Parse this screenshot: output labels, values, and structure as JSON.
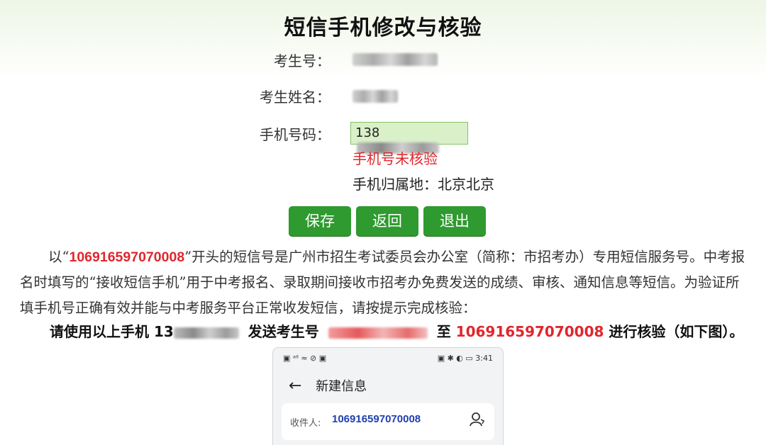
{
  "page": {
    "title": "短信手机修改与核验"
  },
  "form": {
    "exam_id_label": "考生号：",
    "name_label": "考生姓名：",
    "phone_label": "手机号码：",
    "phone_value": "138",
    "phone_status": "手机号未核验",
    "phone_location": "手机归属地：北京北京"
  },
  "buttons": {
    "save": "保存",
    "back": "返回",
    "exit": "退出"
  },
  "notice": {
    "p1_pre": "以“",
    "p1_number": "106916597070008",
    "p1_post": "”开头的短信号是广州市招生考试委员会办公室（简称：市招考办）专用短信服务号。中考报名时填写的“接收短信手机”用于中考报名、录取期间接收市招考办免费发送的成绩、审核、通知信息等短信。为验证所填手机号正确有效并能与中考服务平台正常收发短信，请按提示完成核验：",
    "instr_a": "请使用以上手机 13",
    "instr_b": "发送考生号",
    "instr_c": "至",
    "instr_number": "106916597070008",
    "instr_d": "进行核验（如下图）。"
  },
  "phone_mock": {
    "status_left": "▣ ᵃˡˡ ≈ ⊘ ▣",
    "status_right": "▣ ✱ ◐ ▭ 3:41",
    "nav_title": "新建信息",
    "recipient_label": "收件人:",
    "recipient_number": "106916597070008"
  },
  "colors": {
    "accent_green": "#2f9a2f",
    "input_bg": "#d9f0c8",
    "warning_red": "#e0262d",
    "number_blue": "#1f3fb0"
  }
}
